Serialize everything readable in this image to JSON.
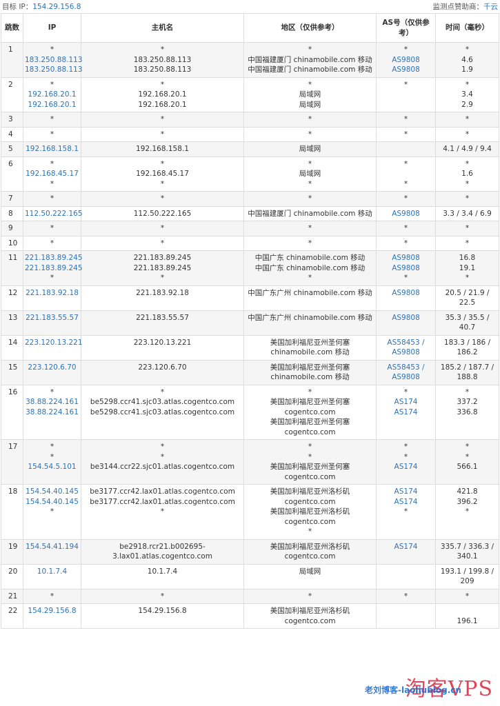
{
  "header": {
    "target_label": "目标 IP：",
    "target_ip": "154.29.156.8",
    "sponsor_label": "监测点赞助商：",
    "sponsor": "千云"
  },
  "columns": {
    "hop": "跳数",
    "ip": "IP",
    "host": "主机名",
    "region": "地区（仅供参考）",
    "as": "AS号（仅供参考）",
    "time": "时间（毫秒）"
  },
  "rows": [
    {
      "hop": "1",
      "ip": [
        "*",
        "183.250.88.113",
        "183.250.88.113"
      ],
      "host": [
        "*",
        "183.250.88.113",
        "183.250.88.113"
      ],
      "region": [
        "*",
        "中国福建厦门 chinamobile.com 移动",
        "中国福建厦门 chinamobile.com 移动"
      ],
      "as": [
        "*",
        "AS9808",
        "AS9808"
      ],
      "time": [
        "*",
        "4.6",
        "1.9"
      ]
    },
    {
      "hop": "2",
      "ip": [
        "*",
        "192.168.20.1",
        "192.168.20.1"
      ],
      "host": [
        "*",
        "192.168.20.1",
        "192.168.20.1"
      ],
      "region": [
        "*",
        "局域网",
        "局域网"
      ],
      "as": [
        "*"
      ],
      "time": [
        "*",
        "3.4",
        "2.9"
      ]
    },
    {
      "hop": "3",
      "ip": [
        "*"
      ],
      "host": [
        "*"
      ],
      "region": [
        "*"
      ],
      "as": [
        "*"
      ],
      "time": [
        "*"
      ]
    },
    {
      "hop": "4",
      "ip": [
        "*"
      ],
      "host": [
        "*"
      ],
      "region": [
        "*"
      ],
      "as": [
        "*"
      ],
      "time": [
        "*"
      ]
    },
    {
      "hop": "5",
      "ip": [
        "192.168.158.1"
      ],
      "host": [
        "192.168.158.1"
      ],
      "region": [
        "局域网"
      ],
      "as": [],
      "time": [
        "4.1 / 4.9 / 9.4"
      ]
    },
    {
      "hop": "6",
      "ip": [
        "*",
        "192.168.45.17",
        "*"
      ],
      "host": [
        "*",
        "192.168.45.17",
        "*"
      ],
      "region": [
        "*",
        "局域网",
        "*"
      ],
      "as": [
        "*",
        "",
        "*"
      ],
      "time": [
        "*",
        "1.6",
        "*"
      ]
    },
    {
      "hop": "7",
      "ip": [
        "*"
      ],
      "host": [
        "*"
      ],
      "region": [
        "*"
      ],
      "as": [
        "*"
      ],
      "time": [
        "*"
      ]
    },
    {
      "hop": "8",
      "ip": [
        "112.50.222.165"
      ],
      "host": [
        "112.50.222.165"
      ],
      "region": [
        "中国福建厦门 chinamobile.com 移动"
      ],
      "as": [
        "AS9808"
      ],
      "time": [
        "3.3 / 3.4 / 6.9"
      ]
    },
    {
      "hop": "9",
      "ip": [
        "*"
      ],
      "host": [
        "*"
      ],
      "region": [
        "*"
      ],
      "as": [
        "*"
      ],
      "time": [
        "*"
      ]
    },
    {
      "hop": "10",
      "ip": [
        "*"
      ],
      "host": [
        "*"
      ],
      "region": [
        "*"
      ],
      "as": [
        "*"
      ],
      "time": [
        "*"
      ]
    },
    {
      "hop": "11",
      "ip": [
        "221.183.89.245",
        "221.183.89.245",
        "*"
      ],
      "host": [
        "221.183.89.245",
        "221.183.89.245",
        "*"
      ],
      "region": [
        "中国广东 chinamobile.com 移动",
        "中国广东 chinamobile.com 移动",
        "*"
      ],
      "as": [
        "AS9808",
        "AS9808",
        "*"
      ],
      "time": [
        "16.8",
        "19.1",
        "*"
      ]
    },
    {
      "hop": "12",
      "ip": [
        "221.183.92.18"
      ],
      "host": [
        "221.183.92.18"
      ],
      "region": [
        "中国广东广州 chinamobile.com 移动"
      ],
      "as": [
        "AS9808"
      ],
      "time": [
        "20.5 / 21.9 /",
        "22.5"
      ]
    },
    {
      "hop": "13",
      "ip": [
        "221.183.55.57"
      ],
      "host": [
        "221.183.55.57"
      ],
      "region": [
        "中国广东广州 chinamobile.com 移动"
      ],
      "as": [
        "AS9808"
      ],
      "time": [
        "35.3 / 35.5 /",
        "40.7"
      ]
    },
    {
      "hop": "14",
      "ip": [
        "223.120.13.221"
      ],
      "host": [
        "223.120.13.221"
      ],
      "region": [
        "美国加利福尼亚州圣何塞",
        "chinamobile.com 移动"
      ],
      "as": [
        "AS58453 /",
        "AS9808"
      ],
      "time": [
        "183.3 / 186 /",
        "186.2"
      ]
    },
    {
      "hop": "15",
      "ip": [
        "223.120.6.70"
      ],
      "host": [
        "223.120.6.70"
      ],
      "region": [
        "美国加利福尼亚州圣何塞",
        "chinamobile.com 移动"
      ],
      "as": [
        "AS58453 /",
        "AS9808"
      ],
      "time": [
        "185.2 / 187.7 /",
        "188.8"
      ]
    },
    {
      "hop": "16",
      "ip": [
        "*",
        "38.88.224.161",
        "38.88.224.161"
      ],
      "host": [
        "*",
        "be5298.ccr41.sjc03.atlas.cogentco.com",
        "be5298.ccr41.sjc03.atlas.cogentco.com"
      ],
      "region": [
        "*",
        "美国加利福尼亚州圣何塞",
        "cogentco.com",
        "美国加利福尼亚州圣何塞",
        "cogentco.com"
      ],
      "as": [
        "*",
        "AS174",
        "AS174"
      ],
      "time": [
        "*",
        "337.2",
        "336.8"
      ]
    },
    {
      "hop": "17",
      "ip": [
        "*",
        "*",
        "154.54.5.101"
      ],
      "host": [
        "*",
        "*",
        "be3144.ccr22.sjc01.atlas.cogentco.com"
      ],
      "region": [
        "*",
        "*",
        "美国加利福尼亚州圣何塞",
        "cogentco.com"
      ],
      "as": [
        "*",
        "*",
        "AS174"
      ],
      "time": [
        "*",
        "*",
        "566.1"
      ]
    },
    {
      "hop": "18",
      "ip": [
        "154.54.40.145",
        "154.54.40.145",
        "*"
      ],
      "host": [
        "be3177.ccr42.lax01.atlas.cogentco.com",
        "be3177.ccr42.lax01.atlas.cogentco.com",
        "*"
      ],
      "region": [
        "美国加利福尼亚州洛杉矶",
        "cogentco.com",
        "美国加利福尼亚州洛杉矶",
        "cogentco.com",
        "*"
      ],
      "as": [
        "AS174",
        "AS174",
        "*"
      ],
      "time": [
        "421.8",
        "396.2",
        "*"
      ]
    },
    {
      "hop": "19",
      "ip": [
        "154.54.41.194"
      ],
      "host": [
        "be2918.rcr21.b002695-",
        "3.lax01.atlas.cogentco.com"
      ],
      "region": [
        "美国加利福尼亚州洛杉矶",
        "cogentco.com"
      ],
      "as": [
        "AS174"
      ],
      "time": [
        "335.7 / 336.3 /",
        "340.1"
      ]
    },
    {
      "hop": "20",
      "ip": [
        "10.1.7.4"
      ],
      "host": [
        "10.1.7.4"
      ],
      "region": [
        "局域网"
      ],
      "as": [],
      "time": [
        "193.1 / 199.8 /",
        "209"
      ]
    },
    {
      "hop": "21",
      "ip": [
        "*"
      ],
      "host": [
        "*"
      ],
      "region": [
        "*"
      ],
      "as": [
        "*"
      ],
      "time": [
        "*"
      ]
    },
    {
      "hop": "22",
      "ip": [
        "154.29.156.8"
      ],
      "host": [
        "154.29.156.8"
      ],
      "region": [
        "美国加利福尼亚州洛杉矶",
        "cogentco.com"
      ],
      "as": [],
      "time": [
        "",
        "196.1"
      ]
    }
  ],
  "watermark": {
    "big": "淘客VPS",
    "small": "老刘博客-laoliublog.cn"
  }
}
